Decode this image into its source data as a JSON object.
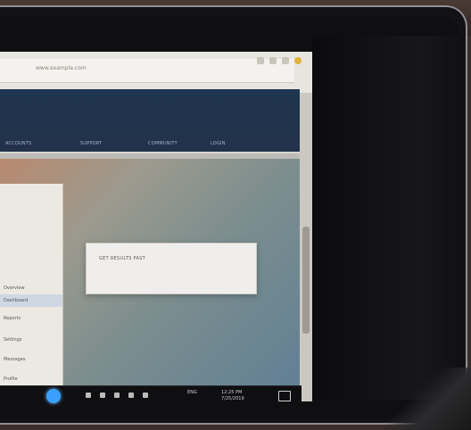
{
  "browser": {
    "address_text": "www.example.com",
    "extensions": [
      "ext-1",
      "ext-2",
      "ext-3",
      "ext-4"
    ]
  },
  "site": {
    "nav": [
      "ACCOUNTS",
      "SUPPORT",
      "COMMUNITY",
      "LOGIN"
    ],
    "left_panel": [
      "Overview",
      "Dashboard",
      "Reports",
      "Settings",
      "Messages",
      "Profile"
    ],
    "card_text": "GET RESULTS FAST"
  },
  "taskbar": {
    "time": "12:25 PM",
    "date": "7/25/2019",
    "lang": "ENG"
  },
  "colors": {
    "header": "#1f3550",
    "start": "#3aa0ff"
  }
}
